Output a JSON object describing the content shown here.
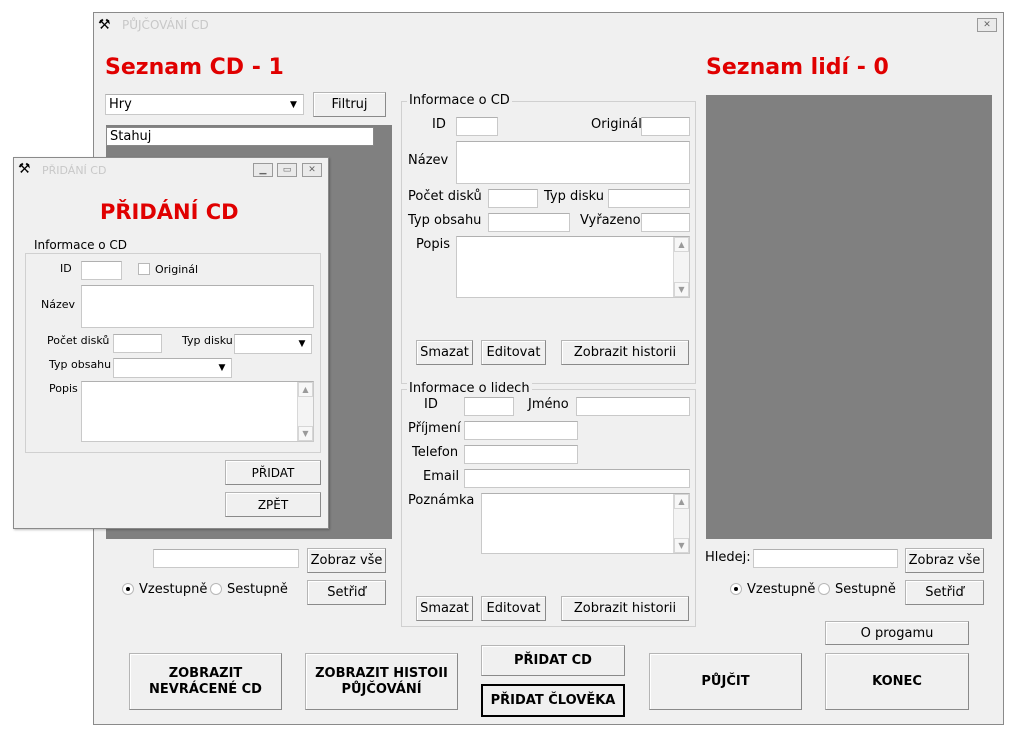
{
  "main_window": {
    "title": "PŮJČOVÁNÍ CD",
    "cd_list_heading": "Seznam CD - 1",
    "people_list_heading": "Seznam lidí - 0",
    "category_select_value": "Hry",
    "filter_button": "Filtruj",
    "cd_list_items": [
      "Stahuj"
    ],
    "cd_search_value": "",
    "show_all_button": "Zobraz vše",
    "sort_asc_label": "Vzestupně",
    "sort_desc_label": "Sestupně",
    "sort_button": "Setřiď",
    "cd_info": {
      "legend": "Informace o CD",
      "id_label": "ID",
      "original_label": "Originál",
      "name_label": "Název",
      "disk_count_label": "Počet disků",
      "disk_type_label": "Typ disku",
      "content_type_label": "Typ obsahu",
      "discarded_label": "Vyřazeno",
      "description_label": "Popis",
      "delete_button": "Smazat",
      "edit_button": "Editovat",
      "history_button": "Zobrazit historii"
    },
    "people_info": {
      "legend": "Informace o lidech",
      "id_label": "ID",
      "first_name_label": "Jméno",
      "last_name_label": "Příjmení",
      "phone_label": "Telefon",
      "email_label": "Email",
      "note_label": "Poznámka",
      "delete_button": "Smazat",
      "edit_button": "Editovat",
      "history_button": "Zobrazit historii"
    },
    "people_search_label": "Hledej:",
    "people_search_value": "",
    "people_show_all_button": "Zobraz vše",
    "people_sort_asc_label": "Vzestupně",
    "people_sort_desc_label": "Sestupně",
    "people_sort_button": "Setřiď",
    "about_button": "O progamu",
    "bottom": {
      "show_unreturned_line1": "ZOBRAZIT",
      "show_unreturned_line2": "NEVRÁCENÉ CD",
      "show_history_line1": "ZOBRAZIT HISTOII",
      "show_history_line2": "PŮJČOVÁNÍ",
      "add_cd": "PŘIDAT CD",
      "add_person": "PŘIDAT ČLOVĚKA",
      "lend": "PŮJČIT",
      "quit": "KONEC"
    }
  },
  "dialog": {
    "title": "PŘIDÁNÍ CD",
    "heading": "PŘIDÁNÍ CD",
    "legend": "Informace o CD",
    "id_label": "ID",
    "original_label": "Originál",
    "name_label": "Název",
    "disk_count_label": "Počet disků",
    "disk_type_label": "Typ disku",
    "content_type_label": "Typ obsahu",
    "description_label": "Popis",
    "add_button": "PŘIDAT",
    "back_button": "ZPĚT"
  },
  "colors": {
    "heading_red": "#e00000",
    "list_gray": "#808080",
    "window_bg": "#f0f0f0"
  }
}
